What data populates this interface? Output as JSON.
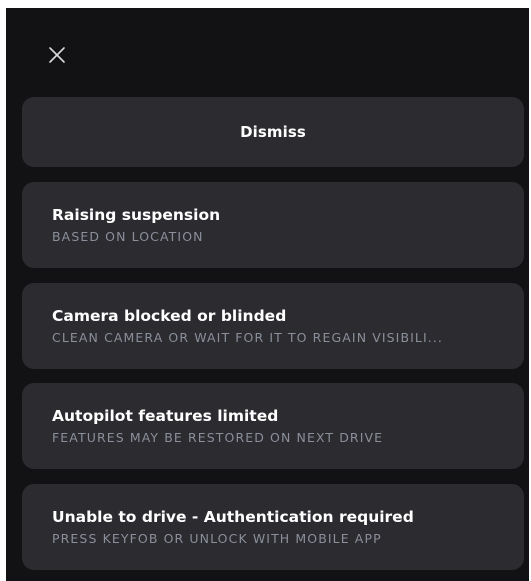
{
  "close": {
    "icon": "close-icon"
  },
  "dismiss": {
    "label": "Dismiss"
  },
  "alerts": [
    {
      "title": "Raising suspension",
      "subtitle": "BASED ON LOCATION"
    },
    {
      "title": "Camera blocked or blinded",
      "subtitle": "CLEAN CAMERA OR WAIT FOR IT TO REGAIN VISIBILI..."
    },
    {
      "title": "Autopilot features limited",
      "subtitle": "FEATURES MAY BE RESTORED ON NEXT DRIVE"
    },
    {
      "title": "Unable to drive - Authentication required",
      "subtitle": "PRESS KEYFOB OR UNLOCK WITH MOBILE APP"
    }
  ],
  "colors": {
    "background": "#121214",
    "card": "#2b2b30",
    "title": "#ffffff",
    "subtitle": "#8a8f9a"
  }
}
